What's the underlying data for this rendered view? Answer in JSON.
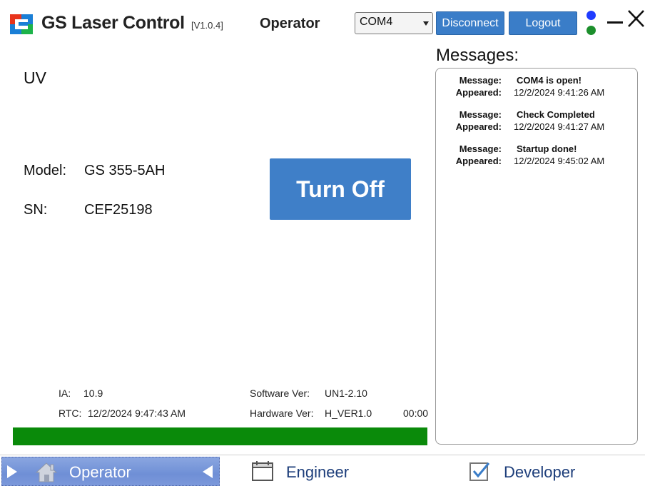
{
  "header": {
    "title": "GS Laser Control",
    "version": "[V1.0.4]",
    "role": "Operator",
    "port": "COM4",
    "disconnect_label": "Disconnect",
    "logout_label": "Logout",
    "led_top_color": "#1f3cff",
    "led_bottom_color": "#1c8f2c"
  },
  "main": {
    "mode": "UV",
    "model_key": "Model:",
    "model_value": "GS 355-5AH",
    "sn_key": "SN:",
    "sn_value": "CEF25198",
    "turn_off_label": "Turn Off"
  },
  "status": {
    "ia_key": "IA:",
    "ia_value": "10.9",
    "rtc_key": "RTC:",
    "rtc_value": "12/2/2024 9:47:43 AM",
    "software_key": "Software Ver:",
    "software_value": "UN1-2.10",
    "hardware_key": "Hardware Ver:",
    "hardware_value": "H_VER1.0",
    "timer": "00:00",
    "progress_fraction": 1.0,
    "progress_color": "#0a8a0a"
  },
  "messages": {
    "title": "Messages:",
    "message_key": "Message:",
    "appeared_key": "Appeared:",
    "items": [
      {
        "text": "COM4 is open!",
        "time": "12/2/2024 9:41:26 AM"
      },
      {
        "text": "Check Completed",
        "time": "12/2/2024 9:41:27 AM"
      },
      {
        "text": "Startup done!",
        "time": "12/2/2024 9:45:02 AM"
      }
    ]
  },
  "nav": {
    "operator": "Operator",
    "engineer": "Engineer",
    "developer": "Developer"
  },
  "icons": {
    "logo": "gs-logo-icon",
    "home": "home-icon",
    "engineer": "folder-icon",
    "developer": "checkbox-icon",
    "minimize": "minimize-icon",
    "close": "close-icon"
  }
}
